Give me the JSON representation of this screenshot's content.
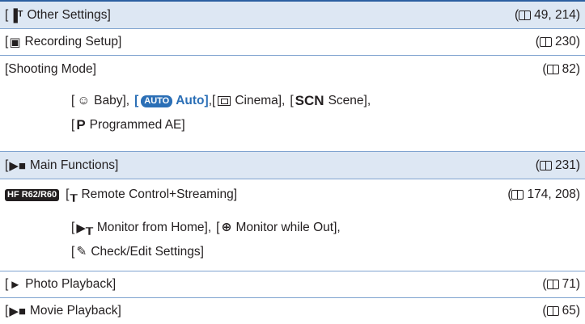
{
  "rows": [
    {
      "label": "Other Settings]",
      "prefix": "[",
      "icon": "tools-icon",
      "icon_glyph": "⁞⊺",
      "ref": "49, 214"
    },
    {
      "label": "Recording Setup]",
      "prefix": "[",
      "icon": "camera-settings-icon",
      "icon_glyph": "▘",
      "ref": "230"
    },
    {
      "label": "[Shooting Mode]",
      "ref": "82"
    },
    {
      "label": "Main Functions]",
      "prefix": "[",
      "icon": "movie-camera-icon",
      "icon_glyph": "⁍",
      "ref": "231"
    },
    {
      "label": "Remote Control+Streaming]",
      "prefix": "[",
      "model_badge": "HF R62/R60",
      "icon": "remote-icon",
      "icon_glyph": "ǟ",
      "ref": "174, 208"
    },
    {
      "label": "Photo Playback]",
      "prefix": "[",
      "icon": "camera-icon",
      "icon_glyph": "▰",
      "ref": "71"
    },
    {
      "label": "Movie Playback]",
      "prefix": "[",
      "icon": "film-playback-icon",
      "icon_glyph": "⁍",
      "ref": "65"
    }
  ],
  "shooting_modes": {
    "baby_prefix": "[",
    "baby_icon": "☺",
    "baby_label": "Baby],",
    "auto_open": "[",
    "auto_badge": "AUTO",
    "auto_label": "Auto]",
    "cinema_prefix": ",[",
    "cinema_label": "Cinema],",
    "scn_prefix": "[",
    "scn_badge": "SCN",
    "scn_label": "Scene],",
    "p_prefix": "[",
    "p_badge": "P",
    "p_label": "Programmed AE]"
  },
  "remote_sub": {
    "monitor_home_prefix": "[",
    "monitor_home_icon": "ꟷ",
    "monitor_home_label": "Monitor from Home],",
    "monitor_out_prefix": "[",
    "monitor_out_icon": "⊕",
    "monitor_out_label": "Monitor while Out],",
    "check_prefix": "[",
    "check_icon": "✎",
    "check_label": "Check/Edit Settings]"
  },
  "colors": {
    "accent": "#2b6fb6",
    "rule": "#7fa3cf",
    "row_bg": "#dde7f3"
  }
}
